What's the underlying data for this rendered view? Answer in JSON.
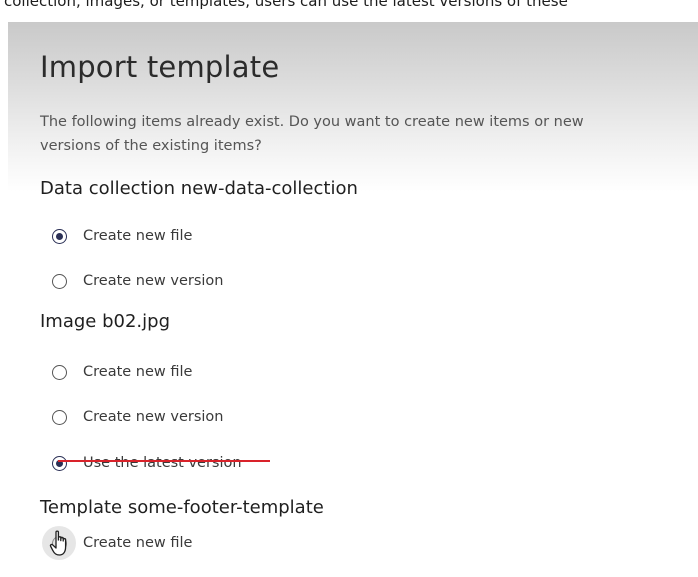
{
  "background_caption": "collection, images, or templates, users can use the latest versions of these",
  "dialog": {
    "title": "Import template",
    "description": "The following items already exist. Do you want to create new items or new versions of the existing items?",
    "sections": [
      {
        "heading": "Data collection new-data-collection",
        "options": [
          {
            "label": "Create new file",
            "checked": true
          },
          {
            "label": "Create new version",
            "checked": false
          }
        ]
      },
      {
        "heading": "Image b02.jpg",
        "options": [
          {
            "label": "Create new file",
            "checked": false
          },
          {
            "label": "Create new version",
            "checked": false
          },
          {
            "label": "Use the latest version",
            "checked": true
          }
        ]
      },
      {
        "heading": "Template some-footer-template",
        "options": [
          {
            "label": "Create new file",
            "checked": false
          }
        ]
      }
    ]
  },
  "colors": {
    "radio_checked": "#2a2f55",
    "annotation_underline": "#d9222a"
  },
  "icons": {
    "cursor": "hand-pointer-icon"
  }
}
